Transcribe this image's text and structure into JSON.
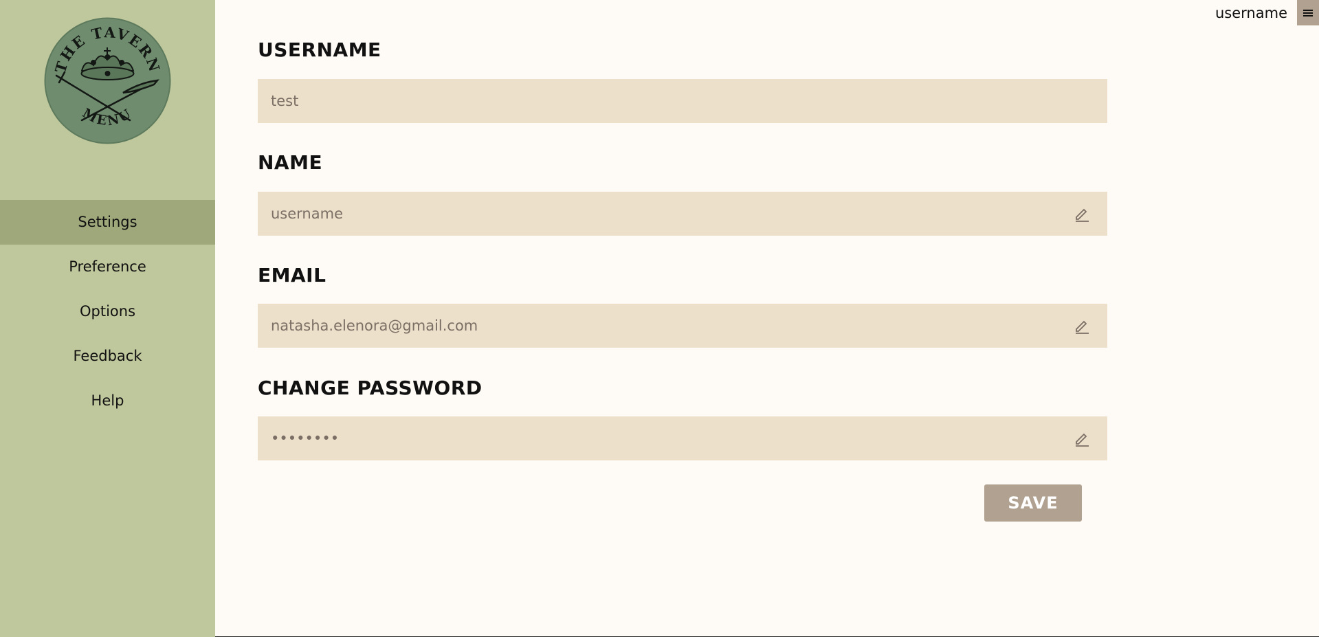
{
  "sidebar": {
    "logo_text_top": "THE TAVERN",
    "logo_text_bottom": "MENU",
    "items": [
      {
        "label": "Settings",
        "active": true
      },
      {
        "label": "Preference"
      },
      {
        "label": "Options"
      },
      {
        "label": "Feedback"
      },
      {
        "label": "Help"
      }
    ]
  },
  "header": {
    "user_name": "username",
    "menu_icon": "hamburger-icon"
  },
  "form": {
    "username": {
      "label": "USERNAME",
      "value": "test"
    },
    "name": {
      "label": "NAME",
      "value": "username"
    },
    "email": {
      "label": "EMAIL",
      "value": "natasha.elenora@gmail.com"
    },
    "password": {
      "label": "CHANGE PASSWORD",
      "value": "••••••••"
    },
    "save_label": "SAVE"
  },
  "colors": {
    "sidebar_bg": "#bfc79c",
    "sidebar_active": "#9ea87b",
    "page_bg": "#fefbf6",
    "field_bg": "#ece0ca",
    "accent": "#b0a190",
    "logo_bg": "#6f8c6f"
  }
}
